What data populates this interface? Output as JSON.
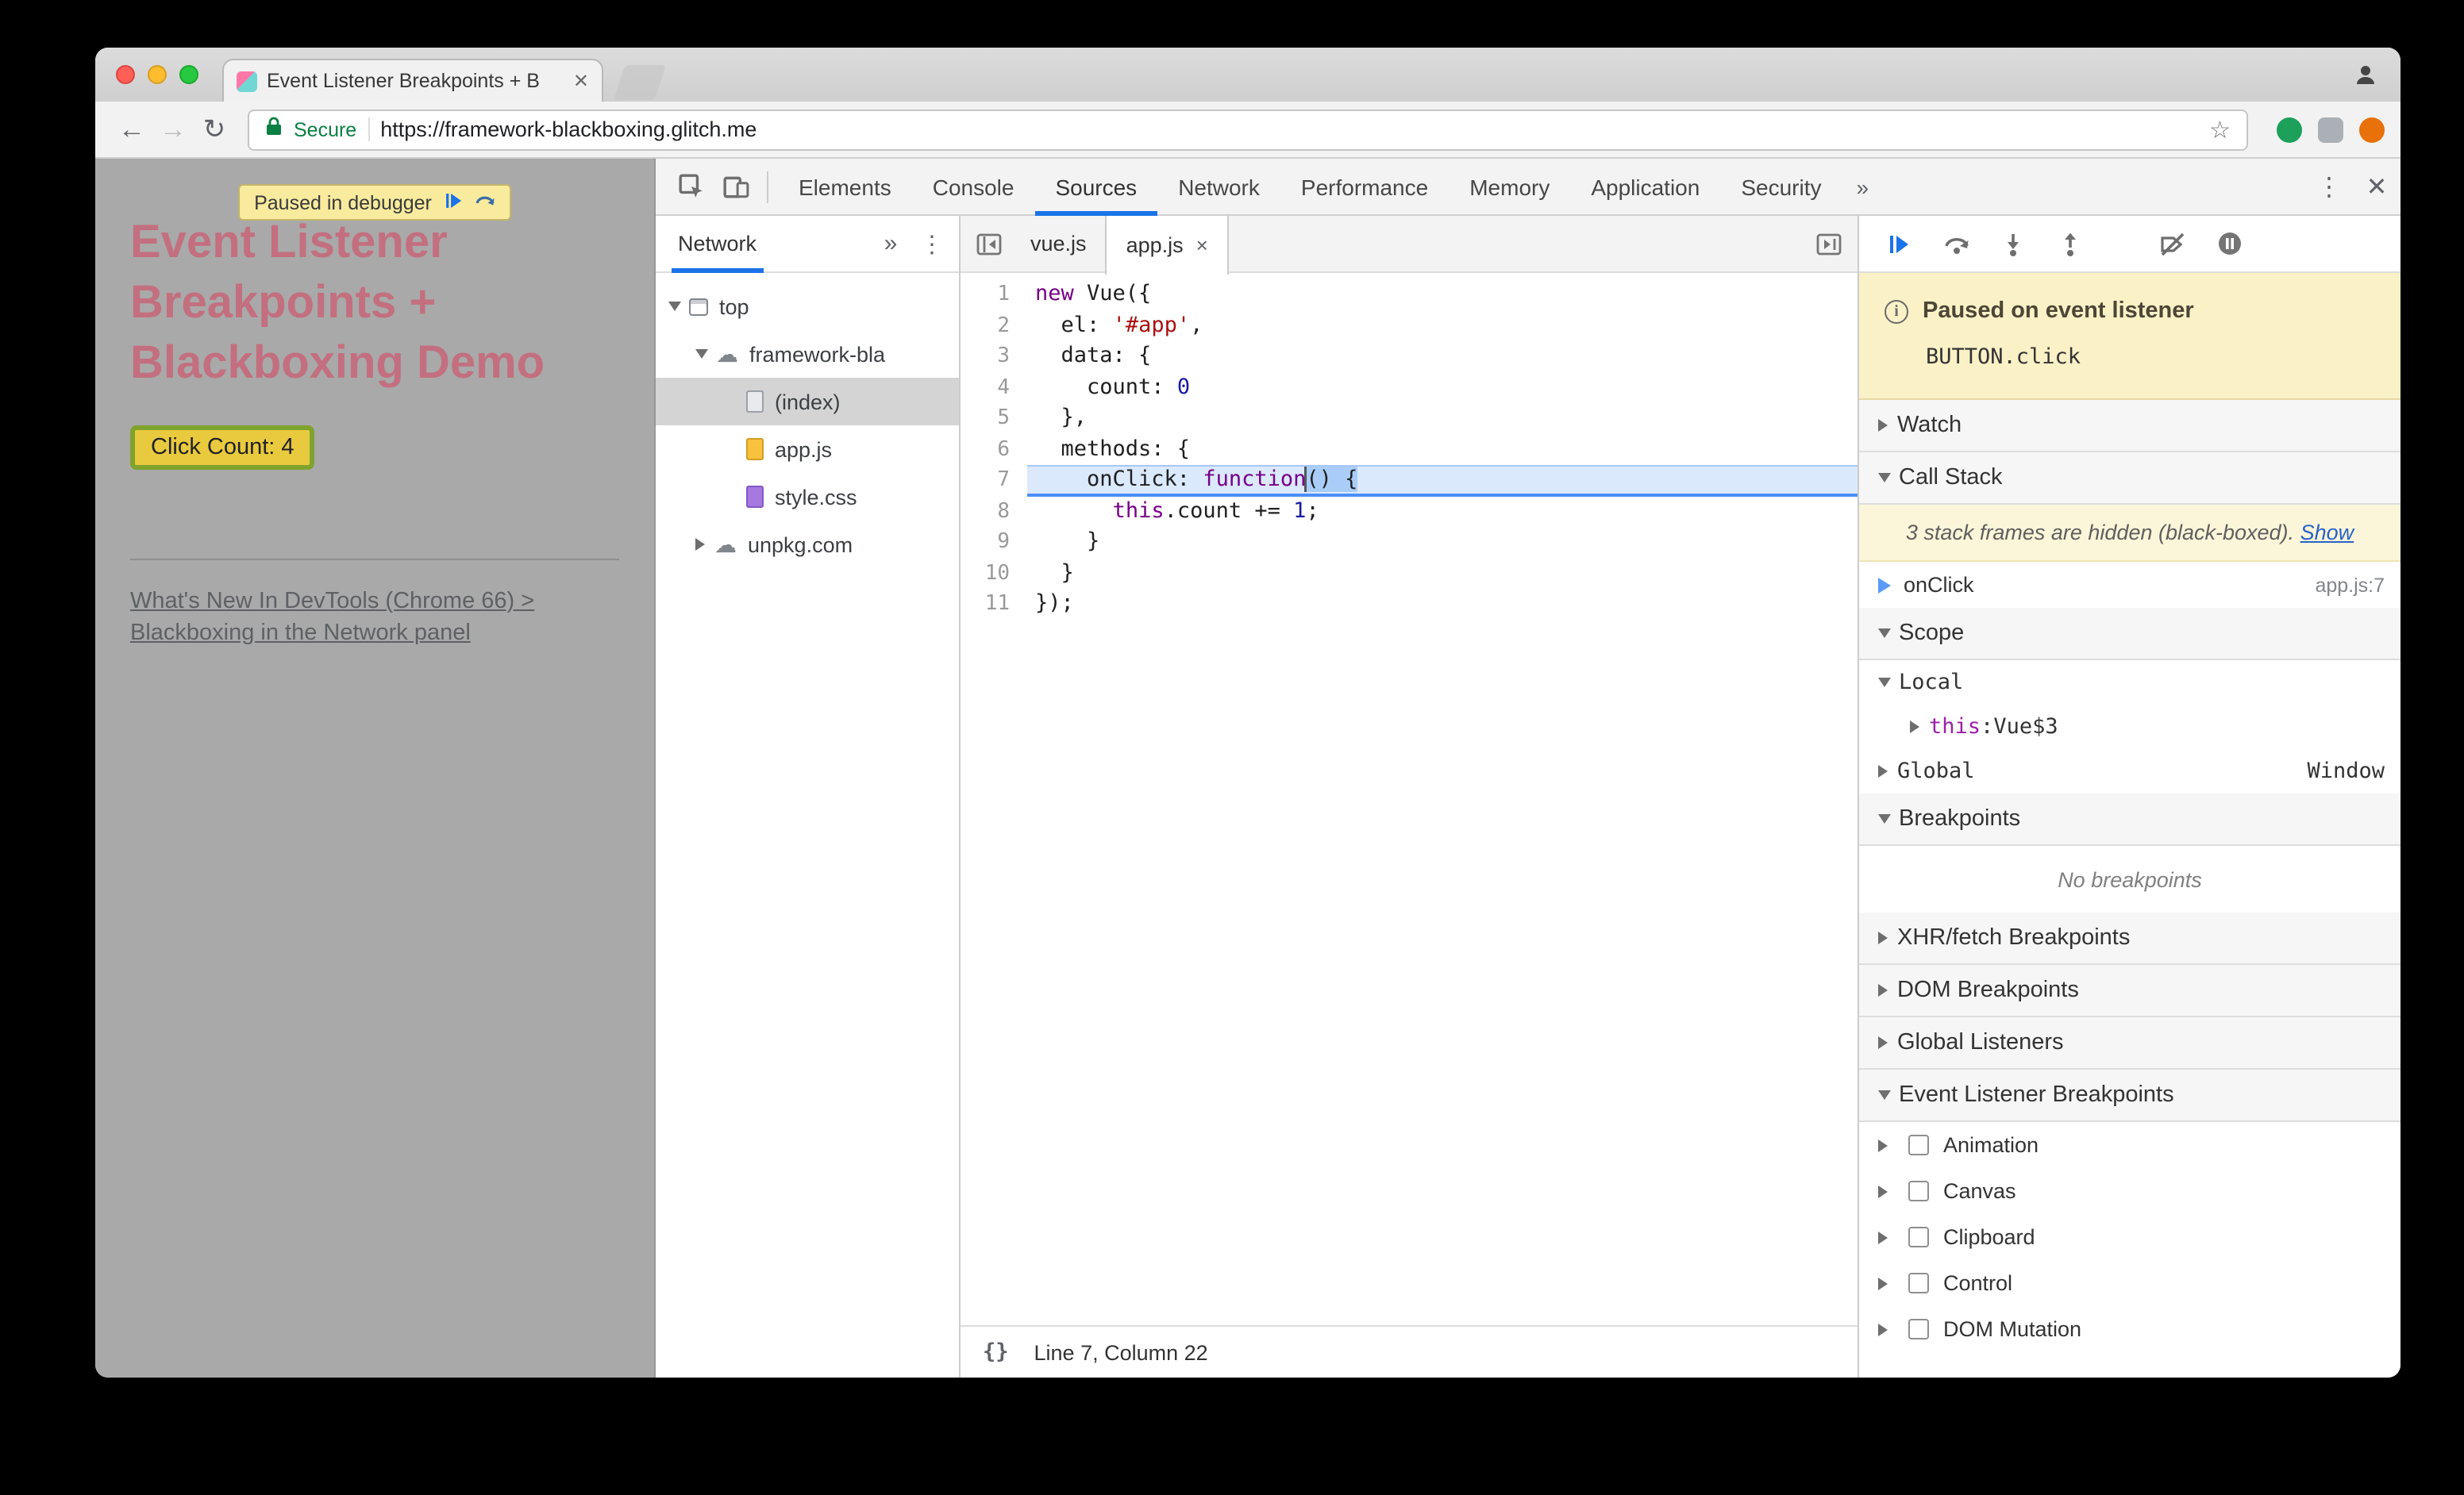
{
  "browser": {
    "tab_title": "Event Listener Breakpoints + B",
    "secure_label": "Secure",
    "url": "https://framework-blackboxing.glitch.me"
  },
  "icons": {
    "back": "←",
    "forward": "→",
    "reload": "↻",
    "star": "☆",
    "overflow_chevrons": "»",
    "menu_dots": "⋮",
    "close": "✕",
    "tab_close": "×",
    "pretty_print": "{}",
    "cloud": "☁"
  },
  "misc": {
    "colon": ": "
  },
  "page": {
    "paused_badge_label": "Paused in debugger",
    "heading": "Event Listener Breakpoints + Blackboxing Demo",
    "button_label": "Click Count: 4",
    "link_line1": "What's New In DevTools (Chrome 66) >",
    "link_line2": "Blackboxing in the Network panel"
  },
  "devtools": {
    "main_tabs": [
      "Elements",
      "Console",
      "Sources",
      "Network",
      "Performance",
      "Memory",
      "Application",
      "Security"
    ],
    "active_tab": "Sources",
    "sidebar": {
      "active_pane": "Network",
      "tree": [
        {
          "label": "top",
          "icon": "frame",
          "arrow": "down",
          "depth": 0
        },
        {
          "label": "framework-bla",
          "icon": "cloud",
          "arrow": "down",
          "depth": 1
        },
        {
          "label": "(index)",
          "icon": "doc",
          "arrow": "none",
          "depth": 2,
          "selected": true
        },
        {
          "label": "app.js",
          "icon": "doc-js",
          "arrow": "none",
          "depth": 2
        },
        {
          "label": "style.css",
          "icon": "doc-css",
          "arrow": "none",
          "depth": 2
        },
        {
          "label": "unpkg.com",
          "icon": "cloud",
          "arrow": "right",
          "depth": 1
        }
      ]
    },
    "editor": {
      "tabs": [
        {
          "label": "vue.js",
          "active": false,
          "closable": false
        },
        {
          "label": "app.js",
          "active": true,
          "closable": true
        }
      ],
      "status_text": "Line 7, Column 22",
      "code": [
        {
          "n": 1,
          "tokens": [
            {
              "t": "new",
              "c": "kw"
            },
            {
              "t": " Vue({"
            }
          ]
        },
        {
          "n": 2,
          "tokens": [
            {
              "t": "  el: "
            },
            {
              "t": "'#app'",
              "c": "str"
            },
            {
              "t": ","
            }
          ]
        },
        {
          "n": 3,
          "tokens": [
            {
              "t": "  data: {"
            }
          ]
        },
        {
          "n": 4,
          "tokens": [
            {
              "t": "    count: "
            },
            {
              "t": "0",
              "c": "num"
            }
          ]
        },
        {
          "n": 5,
          "tokens": [
            {
              "t": "  },"
            }
          ]
        },
        {
          "n": 6,
          "tokens": [
            {
              "t": "  methods: {"
            }
          ]
        },
        {
          "n": 7,
          "exec": true,
          "tokens": [
            {
              "t": "    onClick: "
            },
            {
              "t": "function",
              "c": "kw"
            },
            {
              "t": "() {",
              "c": "sel"
            }
          ]
        },
        {
          "n": 8,
          "tokens": [
            {
              "t": "      "
            },
            {
              "t": "this",
              "c": "kw"
            },
            {
              "t": ".count += "
            },
            {
              "t": "1",
              "c": "num"
            },
            {
              "t": ";"
            }
          ]
        },
        {
          "n": 9,
          "tokens": [
            {
              "t": "    }"
            }
          ]
        },
        {
          "n": 10,
          "tokens": [
            {
              "t": "  }"
            }
          ]
        },
        {
          "n": 11,
          "tokens": [
            {
              "t": "});"
            }
          ]
        }
      ]
    },
    "debugger": {
      "paused_title": "Paused on event listener",
      "paused_detail": "BUTTON.click",
      "sections": {
        "watch": "Watch",
        "call_stack": "Call Stack",
        "scope": "Scope",
        "breakpoints": "Breakpoints",
        "xhr": "XHR/fetch Breakpoints",
        "dom": "DOM Breakpoints",
        "global_listeners": "Global Listeners",
        "event_listener": "Event Listener Breakpoints"
      },
      "blackboxed_message": "3 stack frames are hidden (black-boxed).",
      "show_link": "Show",
      "call_stack_frames": [
        {
          "name": "onClick",
          "location": "app.js:7"
        }
      ],
      "scope_local_label": "Local",
      "scope_this_name": "this",
      "scope_this_value": "Vue$3",
      "scope_global_label": "Global",
      "scope_global_value": "Window",
      "no_breakpoints": "No breakpoints",
      "event_listener_categories": [
        "Animation",
        "Canvas",
        "Clipboard",
        "Control",
        "DOM Mutation"
      ]
    }
  },
  "colors": {
    "devtools_accent": "#1a73e8",
    "secure_green": "#0b8043",
    "paused_banner_bg": "#fbf1c7",
    "exec_line_bg": "#dbe9fd",
    "heading_pink": "#c36f7f",
    "button_yellow": "#e9ca3e",
    "button_border_green": "#7fa32c",
    "keyword_purple": "#770088",
    "string_red": "#aa1111",
    "number_blue": "#1a1aa6"
  }
}
